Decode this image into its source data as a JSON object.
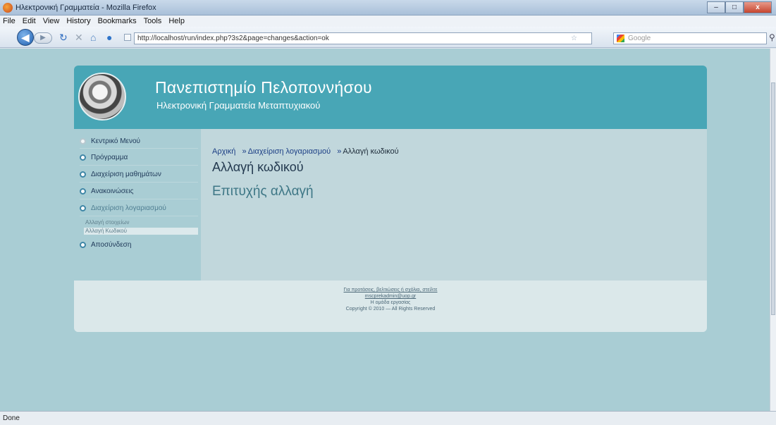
{
  "window": {
    "title": "Ηλεκτρονική Γραμματεία - Mozilla Firefox",
    "minimize": "–",
    "maximize": "□",
    "close": "x"
  },
  "menu": [
    "File",
    "Edit",
    "View",
    "History",
    "Bookmarks",
    "Tools",
    "Help"
  ],
  "browser": {
    "url": "http://localhost/run/index.php?3s2&page=changes&action=ok",
    "search_placeholder": "Google"
  },
  "site": {
    "title": "Πανεπιστημίο Πελοποννήσου",
    "subtitle": "Ηλεκτρονική Γραμματεία Μεταπτυχιακού"
  },
  "sidebar": {
    "items": [
      {
        "label": "Κεντρικό Μενού"
      },
      {
        "label": "Πρόγραμμα"
      },
      {
        "label": "Διαχείριση μαθημάτων"
      },
      {
        "label": "Ανακοινώσεις"
      },
      {
        "label": "Διαχείριση λογαριασμού"
      },
      {
        "label": "Αποσύνδεση"
      }
    ],
    "subitems": [
      {
        "label": "Αλλαγή στοιχείων"
      },
      {
        "label": "Αλλαγή Κωδικού"
      }
    ]
  },
  "breadcrumb": {
    "home": "Αρχική",
    "section": "Διαχείριση λογαριασμού",
    "current": "Αλλαγή κωδικού",
    "separator": "»"
  },
  "content": {
    "heading": "Αλλαγή κωδικού",
    "message": "Επιτυχής αλλαγή"
  },
  "footer": {
    "line1": "Για προτάσεις, βελτιώσεις ή σχόλια, στείλτε",
    "line2": "mscprekadmin@uop.gr",
    "line3": "Η ομάδα εργασίας",
    "copyright": "Copyright © 2010 — All Rights Reserved"
  },
  "status": "Done",
  "colors": {
    "header": "#48a6b6",
    "page_background": "#a9cdd4",
    "content_background": "#c1d7dc",
    "link": "#1c3f85",
    "success": "#3e7786"
  }
}
